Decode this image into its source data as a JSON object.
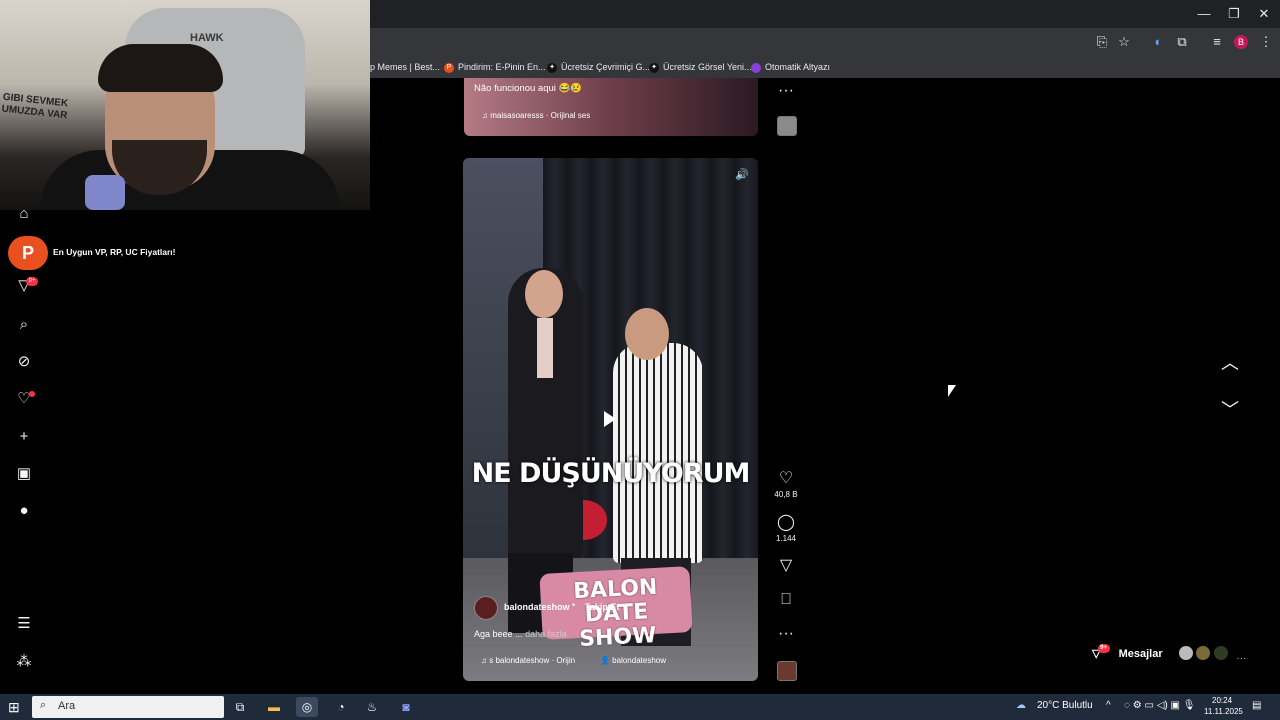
{
  "window": {
    "minimize": "—",
    "restore": "❐",
    "close": "✕"
  },
  "toolbar_icons": [
    "install-icon",
    "star-icon",
    "extension-icon",
    "puzzle-icon",
    "media-icon"
  ],
  "profile": {
    "initial": "B"
  },
  "bookmarks": [
    {
      "label": "p Memes | Best...",
      "color": "#35363a",
      "glyph": ""
    },
    {
      "label": "Pindirim: E-Pinin En...",
      "color": "#e8501f",
      "glyph": "P"
    },
    {
      "label": "Ücretsiz Çevrimiçi G...",
      "color": "#111111",
      "glyph": "✦"
    },
    {
      "label": "Ücretsiz Görsel Yeni...",
      "color": "#111111",
      "glyph": "✦"
    },
    {
      "label": "Otomatik Altyazı",
      "color": "#8b3fd9",
      "glyph": ""
    }
  ],
  "webcam": {
    "wall_text": "GIBI SEVMEK\nUMUZDA VAR",
    "chair_text": "HAWK"
  },
  "promo": {
    "logo": "P",
    "text": "En Uygun VP, RP, UC Fiyatları!"
  },
  "nav": {
    "notif_count": "9+"
  },
  "prev_post": {
    "caption": "Não funcionou aqui 😂😢",
    "audio": "♫ maisasoaresss · Orijinal ses"
  },
  "reel": {
    "title_overlay": "NE DÜŞÜNÜYORUM",
    "show_logo_line1": "BALON DATE",
    "show_logo_line2": "SHOW",
    "username": "balondateshow",
    "dot": "•",
    "follow": "Takip Et",
    "caption": "Aga beee ...",
    "caption_more": "daha fazla",
    "audio": "♫ s  balondateshow · Orijin",
    "tag": "👤 balondateshow",
    "mute": "🔊"
  },
  "actions": {
    "like_count": "40,8 B",
    "comment_count": "1.144"
  },
  "messages": {
    "label": "Mesajlar",
    "badge": "9+",
    "more": "···"
  },
  "taskbar": {
    "search": "Ara",
    "chrome_badge": "8",
    "weather": "20°C  Bulutlu",
    "weather_badge": "1",
    "time": "20:24",
    "date": "11.11.2025"
  }
}
